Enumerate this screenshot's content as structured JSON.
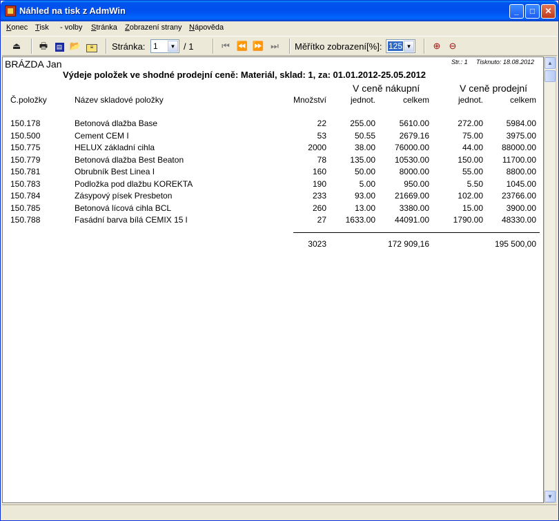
{
  "window": {
    "title": "Náhled na tisk z AdmWin"
  },
  "menu": {
    "items": [
      {
        "u": "K",
        "rest": "onec"
      },
      {
        "u": "T",
        "rest": "isk"
      },
      {
        "u": "",
        "rest": "- volby"
      },
      {
        "u": "S",
        "rest": "tránka"
      },
      {
        "u": "Z",
        "rest": "obrazení strany"
      },
      {
        "u": "N",
        "rest": "ápověda"
      }
    ]
  },
  "toolbar": {
    "page_label": "Stránka:",
    "page_value": "1",
    "page_total": "/ 1",
    "zoom_label": "Měřítko zobrazení[%]:",
    "zoom_value": "125"
  },
  "report": {
    "company": "BRÁZDA Jan",
    "page_info": "Str.: 1",
    "printed": "Tisknuto: 18.08.2012",
    "title": "Výdeje položek ve shodné prodejní ceně: Materiál, sklad:  1, za: 01.01.2012-25.05.2012",
    "group_purchase": "V ceně nákupní",
    "group_sale": "V ceně prodejní",
    "col_code": "Č.položky",
    "col_name": "Název skladové položky",
    "col_qty": "Množství",
    "col_unit": "jednot.",
    "col_total": "celkem",
    "rows": [
      {
        "code": "150.178",
        "name": "Betonová dlažba Base",
        "qty": "22",
        "p_unit": "255.00",
        "p_total": "5610.00",
        "s_unit": "272.00",
        "s_total": "5984.00"
      },
      {
        "code": "150.500",
        "name": "Cement CEM I",
        "qty": "53",
        "p_unit": "50.55",
        "p_total": "2679.16",
        "s_unit": "75.00",
        "s_total": "3975.00"
      },
      {
        "code": "150.775",
        "name": "HELUX základní cihla",
        "qty": "2000",
        "p_unit": "38.00",
        "p_total": "76000.00",
        "s_unit": "44.00",
        "s_total": "88000.00"
      },
      {
        "code": "150.779",
        "name": "Betonová dlažba Best Beaton",
        "qty": "78",
        "p_unit": "135.00",
        "p_total": "10530.00",
        "s_unit": "150.00",
        "s_total": "11700.00"
      },
      {
        "code": "150.781",
        "name": "Obrubník Best Linea I",
        "qty": "160",
        "p_unit": "50.00",
        "p_total": "8000.00",
        "s_unit": "55.00",
        "s_total": "8800.00"
      },
      {
        "code": "150.783",
        "name": "Podložka pod dlažbu KOREKTA",
        "qty": "190",
        "p_unit": "5.00",
        "p_total": "950.00",
        "s_unit": "5.50",
        "s_total": "1045.00"
      },
      {
        "code": "150.784",
        "name": "Zásypový písek Presbeton",
        "qty": "233",
        "p_unit": "93.00",
        "p_total": "21669.00",
        "s_unit": "102.00",
        "s_total": "23766.00"
      },
      {
        "code": "150.785",
        "name": "Betonová lícová cihla BCL",
        "qty": "260",
        "p_unit": "13.00",
        "p_total": "3380.00",
        "s_unit": "15.00",
        "s_total": "3900.00"
      },
      {
        "code": "150.788",
        "name": "Fasádní barva bílá CEMIX 15 l",
        "qty": "27",
        "p_unit": "1633.00",
        "p_total": "44091.00",
        "s_unit": "1790.00",
        "s_total": "48330.00"
      }
    ],
    "totals": {
      "qty": "3023",
      "p_total": "172 909,16",
      "s_total": "195 500,00"
    }
  }
}
